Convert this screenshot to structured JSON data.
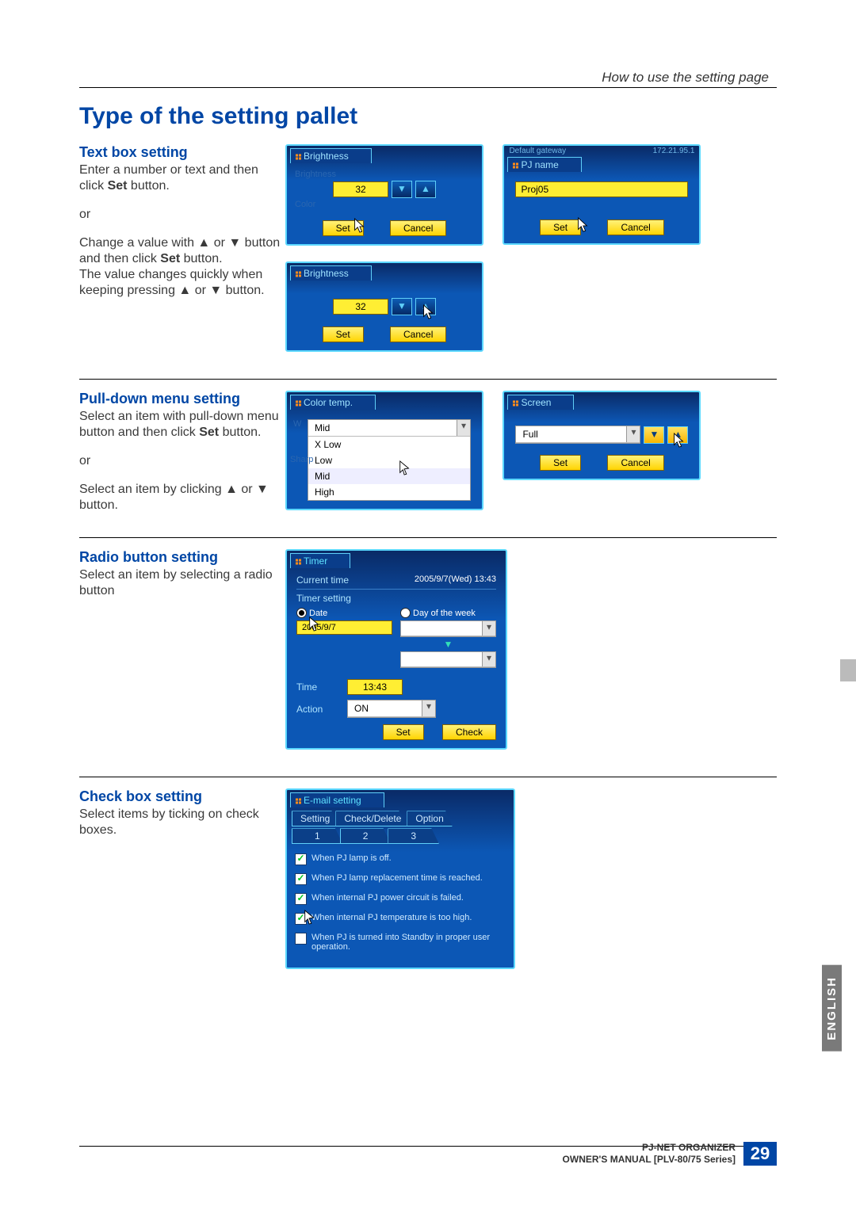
{
  "header": {
    "right_caption": "How to use the setting page"
  },
  "title": "Type of the setting pallet",
  "sections": {
    "textbox": {
      "heading": "Text box setting",
      "p1a": "Enter a number or text and then click ",
      "p1b": "Set",
      "p1c": " button.",
      "or": "or",
      "p2a": "Change a value with ▲ or ▼ button and then click ",
      "p2b": "Set",
      "p2c": " button.\nThe value changes quickly when keeping pressing ▲ or ▼ button.",
      "scr1": {
        "title": "Brightness",
        "bg1": "Brightness",
        "bg2": "Color",
        "value": "32",
        "set": "Set",
        "cancel": "Cancel"
      },
      "scr2": {
        "title": "PJ name",
        "top": "Default gateway",
        "ip": "172.21.95.1",
        "value": "Proj05",
        "set": "Set",
        "cancel": "Cancel"
      },
      "scr3": {
        "title": "Brightness",
        "value": "32",
        "set": "Set",
        "cancel": "Cancel"
      }
    },
    "pulldown": {
      "heading": "Pull-down menu setting",
      "p1a": "Select an item with pull-down menu button and then click ",
      "p1b": "Set",
      "p1c": " button.",
      "or": "or",
      "p2": "Select an item by clicking ▲ or ▼ button.",
      "scr1": {
        "title": "Color temp.",
        "side": "W",
        "side2": "Sharp",
        "selected": "Mid",
        "opts": [
          "X Low",
          "Low",
          "Mid",
          "High"
        ]
      },
      "scr2": {
        "title": "Screen",
        "selected": "Full",
        "set": "Set",
        "cancel": "Cancel"
      }
    },
    "radio": {
      "heading": "Radio button setting",
      "p1": "Select an item by selecting a radio button",
      "scr": {
        "title": "Timer",
        "current_label": "Current time",
        "current_value": "2005/9/7(Wed) 13:43",
        "sub": "Timer setting",
        "r1": "Date",
        "r2": "Day of the week",
        "date": "2005/9/7",
        "time_label": "Time",
        "time": "13:43",
        "action_label": "Action",
        "action": "ON",
        "set": "Set",
        "check": "Check"
      }
    },
    "checkbox": {
      "heading": "Check box setting",
      "p1": "Select items by ticking on check boxes.",
      "scr": {
        "title": "E-mail setting",
        "tabs": [
          "Setting",
          "Check/Delete",
          "Option"
        ],
        "subtabs": [
          "1",
          "2",
          "3"
        ],
        "items": [
          {
            "checked": true,
            "text": "When PJ lamp is off."
          },
          {
            "checked": true,
            "text": "When PJ lamp replacement time is reached."
          },
          {
            "checked": true,
            "text": "When internal PJ power circuit is failed."
          },
          {
            "checked": true,
            "text": "When internal PJ temperature is too high."
          },
          {
            "checked": false,
            "text": "When PJ is turned into Standby in proper user operation."
          }
        ]
      }
    }
  },
  "footer": {
    "product": "PJ-NET ORGANIZER",
    "manual": "OWNER'S MANUAL [PLV-80/75 Series]",
    "page": "29",
    "lang": "ENGLISH"
  }
}
